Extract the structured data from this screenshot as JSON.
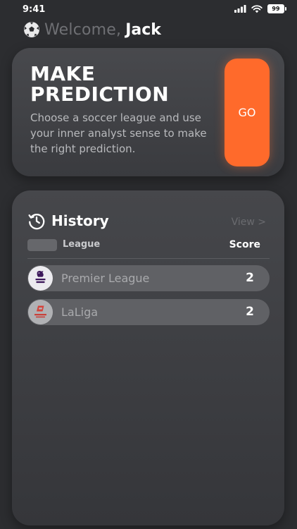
{
  "status_bar": {
    "time": "9:41",
    "battery": "99"
  },
  "header": {
    "welcome_text": "Welcome,",
    "user_name": "Jack"
  },
  "prediction_card": {
    "title_line1": "MAKE",
    "title_line2": "PREDICTION",
    "description": "Choose a soccer league and use your inner analyst sense to make the right prediction.",
    "go_label": "GO",
    "accent_color": "#ff6a2b"
  },
  "history": {
    "title": "History",
    "view_label": "View >",
    "columns": {
      "league": "League",
      "score": "Score"
    },
    "rows": [
      {
        "league": "Premier League",
        "score": "2",
        "logo_icon": "premier-league-logo"
      },
      {
        "league": "LaLiga",
        "score": "2",
        "logo_icon": "laliga-logo"
      }
    ]
  }
}
